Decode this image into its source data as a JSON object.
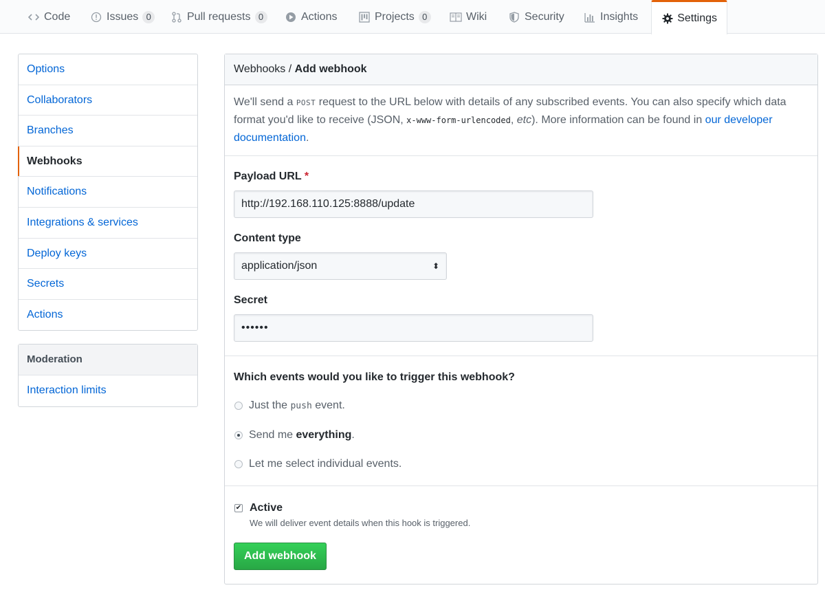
{
  "tabs": [
    {
      "label": "Code",
      "icon": "code-icon"
    },
    {
      "label": "Issues",
      "icon": "issue-icon",
      "count": "0"
    },
    {
      "label": "Pull requests",
      "icon": "pull-request-icon",
      "count": "0"
    },
    {
      "label": "Actions",
      "icon": "play-icon"
    },
    {
      "label": "Projects",
      "icon": "project-icon",
      "count": "0"
    },
    {
      "label": "Wiki",
      "icon": "book-icon"
    },
    {
      "label": "Security",
      "icon": "shield-icon"
    },
    {
      "label": "Insights",
      "icon": "graph-icon"
    },
    {
      "label": "Settings",
      "icon": "gear-icon",
      "selected": true
    }
  ],
  "sidebar": {
    "items": [
      {
        "label": "Options"
      },
      {
        "label": "Collaborators"
      },
      {
        "label": "Branches"
      },
      {
        "label": "Webhooks",
        "selected": true
      },
      {
        "label": "Notifications"
      },
      {
        "label": "Integrations & services"
      },
      {
        "label": "Deploy keys"
      },
      {
        "label": "Secrets"
      },
      {
        "label": "Actions"
      }
    ],
    "moderation": {
      "heading": "Moderation",
      "items": [
        {
          "label": "Interaction limits"
        }
      ]
    }
  },
  "main": {
    "breadcrumb_parent": "Webhooks",
    "breadcrumb_sep": " / ",
    "breadcrumb_current": "Add webhook",
    "intro": {
      "p1": "We'll send a ",
      "post": "POST",
      "p2": " request to the URL below with details of any subscribed events. You can also specify which data format you'd like to receive (JSON, ",
      "code": "x-www-form-urlencoded",
      "p3": ", ",
      "etc": "etc",
      "p4": "). More information can be found in ",
      "link": "our developer documentation",
      "p5": "."
    },
    "payload_url_label": "Payload URL",
    "required_mark": "*",
    "payload_url_value": "http://192.168.110.125:8888/update",
    "content_type_label": "Content type",
    "content_type_value": "application/json",
    "secret_label": "Secret",
    "secret_value": "••••••",
    "events_question": "Which events would you like to trigger this webhook?",
    "events": [
      {
        "pre": "Just the ",
        "code": "push",
        "post": " event.",
        "checked": false
      },
      {
        "pre": "Send me ",
        "bold": "everything",
        "post": ".",
        "checked": true
      },
      {
        "pre": "Let me select individual events.",
        "checked": false
      }
    ],
    "active_label": "Active",
    "active_checked": true,
    "active_note": "We will deliver event details when this hook is triggered.",
    "submit_label": "Add webhook"
  },
  "colors": {
    "accent": "#e36209",
    "link": "#0366d6",
    "button": "#28a745"
  }
}
